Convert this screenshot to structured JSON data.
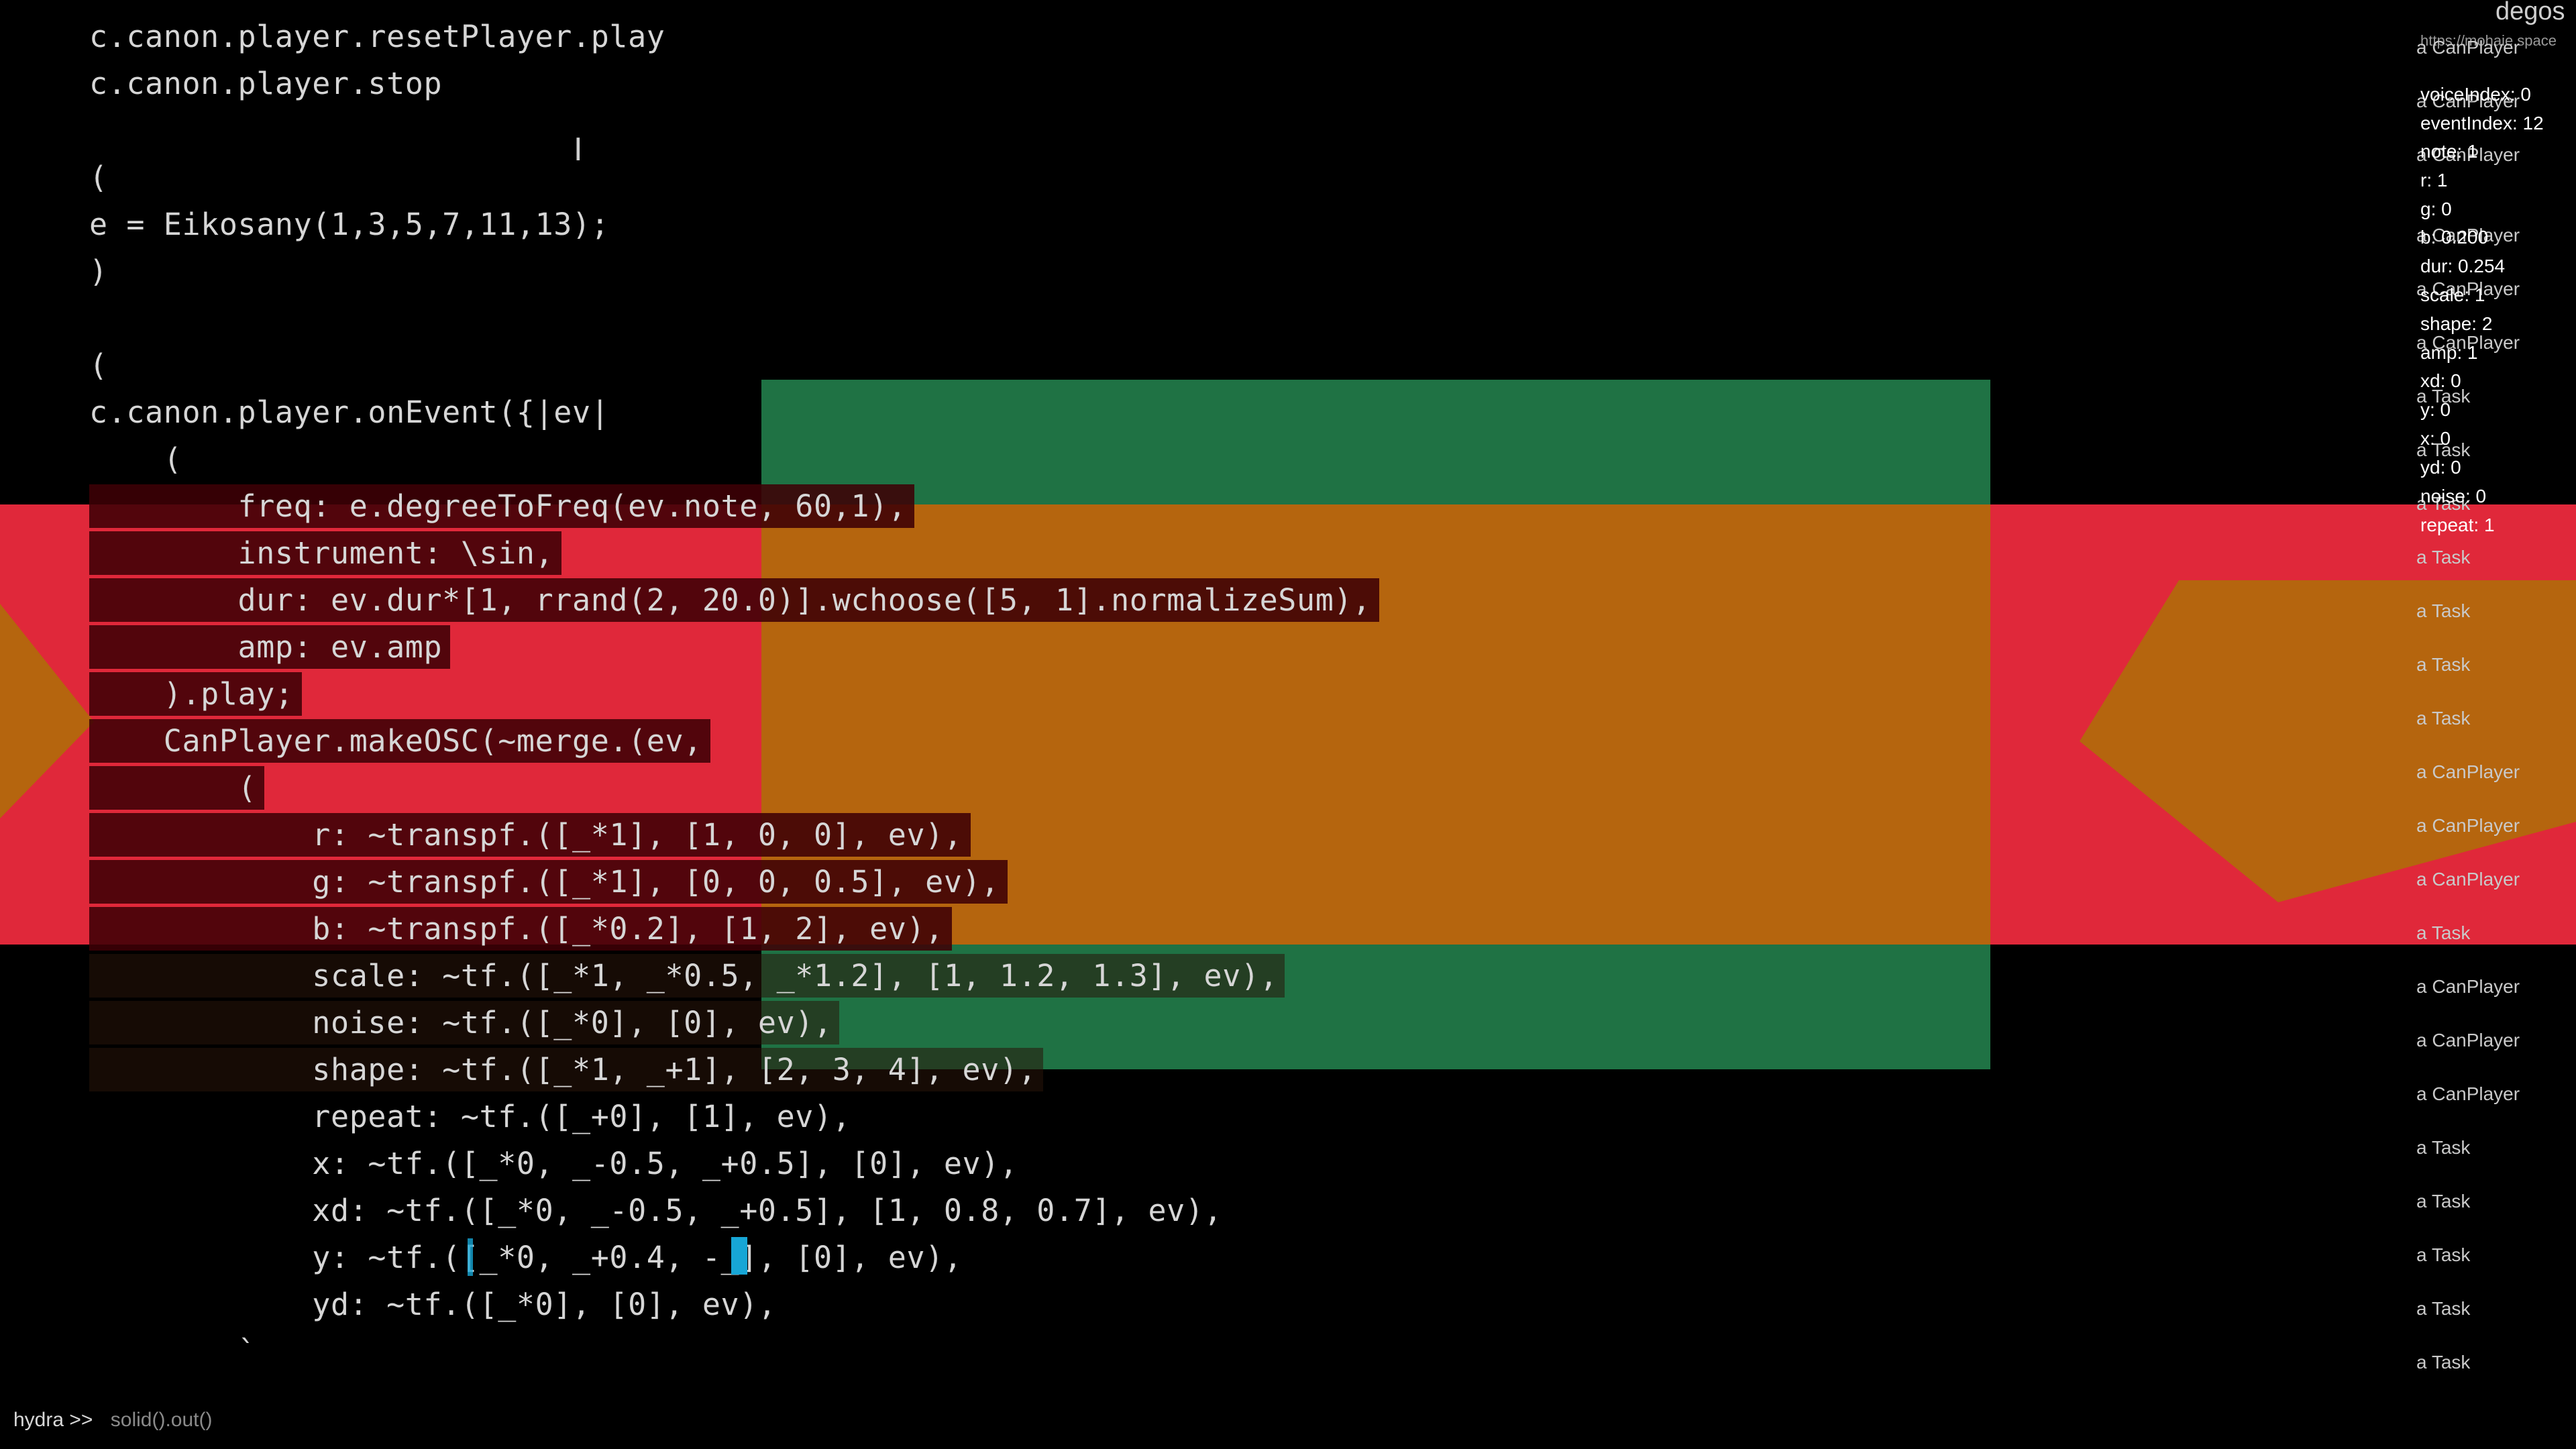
{
  "editor": {
    "lines": [
      "c.canon.player.resetPlayer.play",
      "c.canon.player.stop",
      "",
      "(",
      "e = Eikosany(1,3,5,7,11,13);",
      ")",
      "",
      "(",
      "c.canon.player.onEvent({|ev|",
      "    (",
      "        freq: e.degreeToFreq(ev.note, 60,1),",
      "        instrument: \\sin,",
      "        dur: ev.dur*[1, rrand(2, 20.0)].wchoose([5, 1].normalizeSum),",
      "        amp: ev.amp",
      "    ).play;",
      "    CanPlayer.makeOSC(~merge.(ev,",
      "        (",
      "            r: ~transpf.([_*1], [1, 0, 0], ev),",
      "            g: ~transpf.([_*1], [0, 0, 0.5], ev),",
      "            b: ~transpf.([_*0.2], [1, 2], ev),",
      "            scale: ~tf.([_*1, _*0.5, _*1.2], [1, 1.2, 1.3], ev),",
      "            noise: ~tf.([_*0], [0], ev),",
      "            shape: ~tf.([_*1, _+1], [2, 3, 4], ev),",
      "            repeat: ~tf.([_+0], [1], ev),",
      "            x: ~tf.([_*0, _-0.5, _+0.5], [0], ev),",
      "            xd: ~tf.([_*0, _-0.5, _+0.5], [1, 0.8, 0.7], ev),",
      "            y: ~tf.([_*0, _+0.4, -_], [0], ev),",
      "            yd: ~tf.([_*0], [0], ev),",
      "        `"
    ]
  },
  "overlay": {
    "title": "degos",
    "url": "https://mohaie.space",
    "items": [
      "a CanPlayer",
      "a CanPlayer",
      "a CanPlayer",
      "a CanPlayer",
      "a CanPlayer",
      "a CanPlayer",
      "a Task",
      "a Task",
      "a Task",
      "a Task",
      "a Task",
      "a Task",
      "a Task",
      "a CanPlayer",
      "a CanPlayer",
      "a CanPlayer",
      "a Task",
      "a CanPlayer",
      "a CanPlayer",
      "a CanPlayer",
      "a Task",
      "a Task",
      "a Task",
      "a Task",
      "a Task"
    ],
    "event": [
      "voiceIndex: 0",
      "eventIndex: 12",
      "note: 1",
      "r: 1",
      "g: 0",
      "b: 0.200",
      "dur: 0.254",
      "scale: 1",
      "shape: 2",
      "amp: 1",
      "xd: 0",
      "y: 0",
      "x: 0",
      "yd: 0",
      "noise: 0",
      "repeat: 1"
    ]
  },
  "status": {
    "prompt": "hydra >>",
    "command": "solid().out()"
  },
  "colors": {
    "red": "#e0283a",
    "green": "#1f7244",
    "orange": "#b5650e",
    "cursor": "#17a6d6"
  }
}
